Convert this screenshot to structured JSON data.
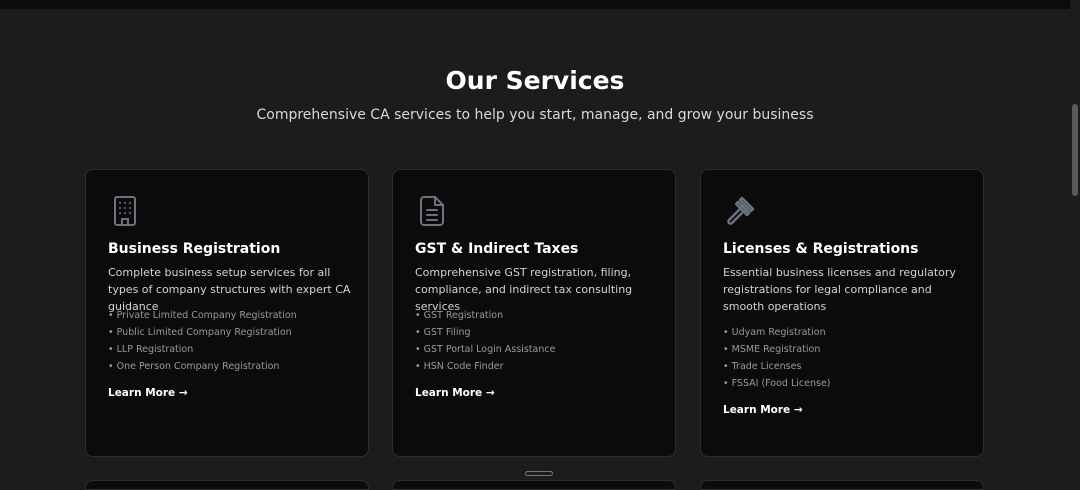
{
  "section": {
    "title": "Our Services",
    "subtitle": "Comprehensive CA services to help you start, manage, and grow your business"
  },
  "cards": [
    {
      "icon": "building-icon",
      "title": "Business Registration",
      "description": "Complete business setup services for all types of company structures with expert CA guidance",
      "items": [
        "Private Limited Company Registration",
        "Public Limited Company Registration",
        "LLP Registration",
        "One Person Company Registration"
      ],
      "link_label": "Learn More →"
    },
    {
      "icon": "document-icon",
      "title": "GST & Indirect Taxes",
      "description": "Comprehensive GST registration, filing, compliance, and indirect tax consulting services",
      "items": [
        "GST Registration",
        "GST Filing",
        "GST Portal Login Assistance",
        "HSN Code Finder"
      ],
      "link_label": "Learn More →"
    },
    {
      "icon": "gavel-icon",
      "title": "Licenses & Registrations",
      "description": "Essential business licenses and regulatory registrations for legal compliance and smooth operations",
      "items": [
        "Udyam Registration",
        "MSME Registration",
        "Trade Licenses",
        "FSSAI (Food License)"
      ],
      "link_label": "Learn More →"
    }
  ],
  "colors": {
    "background": "#1c1c1c",
    "card": "#0b0b0b",
    "icon": "#6b7280"
  }
}
